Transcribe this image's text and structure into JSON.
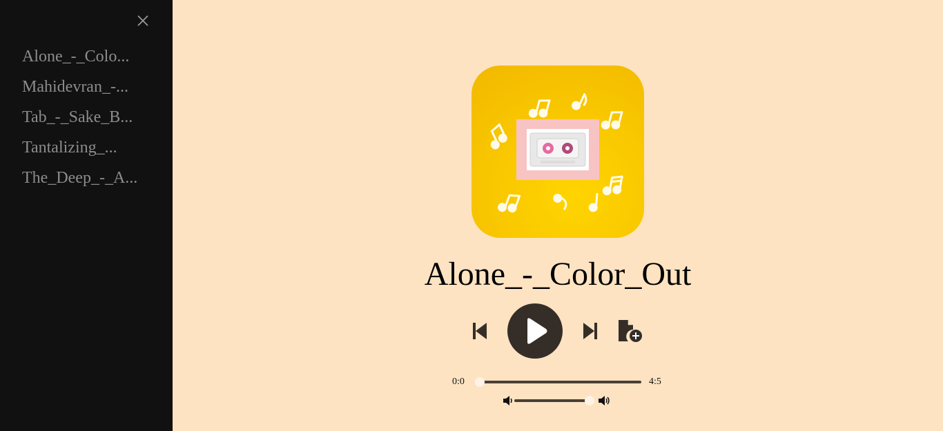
{
  "sidebar": {
    "close_icon": "close-icon",
    "playlist": [
      {
        "label": "Alone_-_Colo..."
      },
      {
        "label": "Mahidevran_-..."
      },
      {
        "label": "Tab_-_Sake_B..."
      },
      {
        "label": "Tantalizing_..."
      },
      {
        "label": "The_Deep_-_A..."
      }
    ]
  },
  "player": {
    "title": "Alone_-_Color_Out",
    "cover_icon": "album-cover-cassette",
    "current_time": "0:0",
    "total_time": "4:5",
    "progress_fraction": 0.0,
    "volume_fraction": 0.95,
    "icons": {
      "prev": "skip-previous-icon",
      "play": "play-icon",
      "next": "skip-next-icon",
      "add": "add-file-icon",
      "volume_low": "volume-low-icon",
      "volume_high": "volume-high-icon"
    }
  },
  "colors": {
    "background": "#fde3c2",
    "sidebar": "#111111",
    "sidebar_text": "#8c8c8c",
    "accent_dark": "#352e28",
    "cover_yellow": "#f8c600"
  }
}
